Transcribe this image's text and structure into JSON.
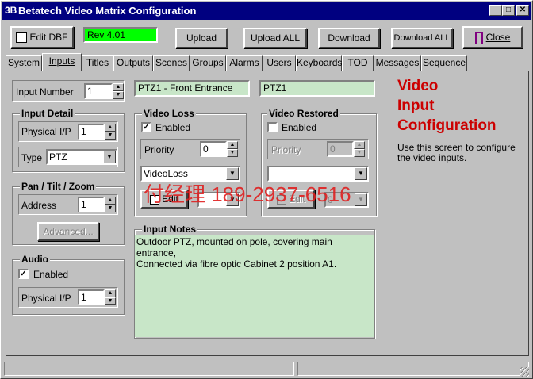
{
  "window": {
    "title": "Betatech Video Matrix Configuration",
    "icon_glyph": "3B",
    "controls": {
      "minimize": "_",
      "maximize": "□",
      "close": "✕"
    }
  },
  "toolbar": {
    "edit_dbf": "Edit DBF",
    "rev": "Rev 4.01",
    "upload": "Upload",
    "upload_all": "Upload ALL",
    "download": "Download",
    "download_all": "Download ALL",
    "close": "Close"
  },
  "tabs": [
    "System",
    "Inputs",
    "Titles",
    "Outputs",
    "Scenes",
    "Groups",
    "Alarms",
    "Users",
    "Keyboards",
    "TOD",
    "Messages",
    "Sequence"
  ],
  "active_tab": "Inputs",
  "input_number": {
    "label": "Input Number",
    "value": "1"
  },
  "title_field": "PTZ1 - Front Entrance",
  "short_field": "PTZ1",
  "input_detail": {
    "title": "Input Detail",
    "physical_label": "Physical I/P",
    "physical_value": "1",
    "type_label": "Type",
    "type_value": "PTZ"
  },
  "ptz": {
    "title": "Pan / Tilt / Zoom",
    "address_label": "Address",
    "address_value": "1",
    "advanced": "Advanced..."
  },
  "audio": {
    "title": "Audio",
    "enabled_label": "Enabled",
    "enabled": true,
    "physical_label": "Physical I/P",
    "physical_value": "1"
  },
  "video_loss": {
    "title": "Video Loss",
    "enabled_label": "Enabled",
    "enabled": true,
    "priority_label": "Priority",
    "priority_value": "0",
    "message_value": "VideoLoss",
    "edit_label": "Edit",
    "extra_value": ""
  },
  "video_restored": {
    "title": "Video Restored",
    "enabled_label": "Enabled",
    "enabled": false,
    "priority_label": "Priority",
    "priority_value": "0",
    "message_value": "",
    "edit_label": "Edit",
    "extra_value": "0"
  },
  "notes": {
    "title": "Input Notes",
    "line1": "Outdoor PTZ, mounted on pole, covering main entrance,",
    "line2": "Connected via fibre optic  Cabinet 2 position A1."
  },
  "info": {
    "heading1": "Video",
    "heading2": "Input",
    "heading3": "Configuration",
    "desc1": "Use this screen to configure",
    "desc2": "the video inputs."
  },
  "watermark": "付经理 189-2937-6516"
}
